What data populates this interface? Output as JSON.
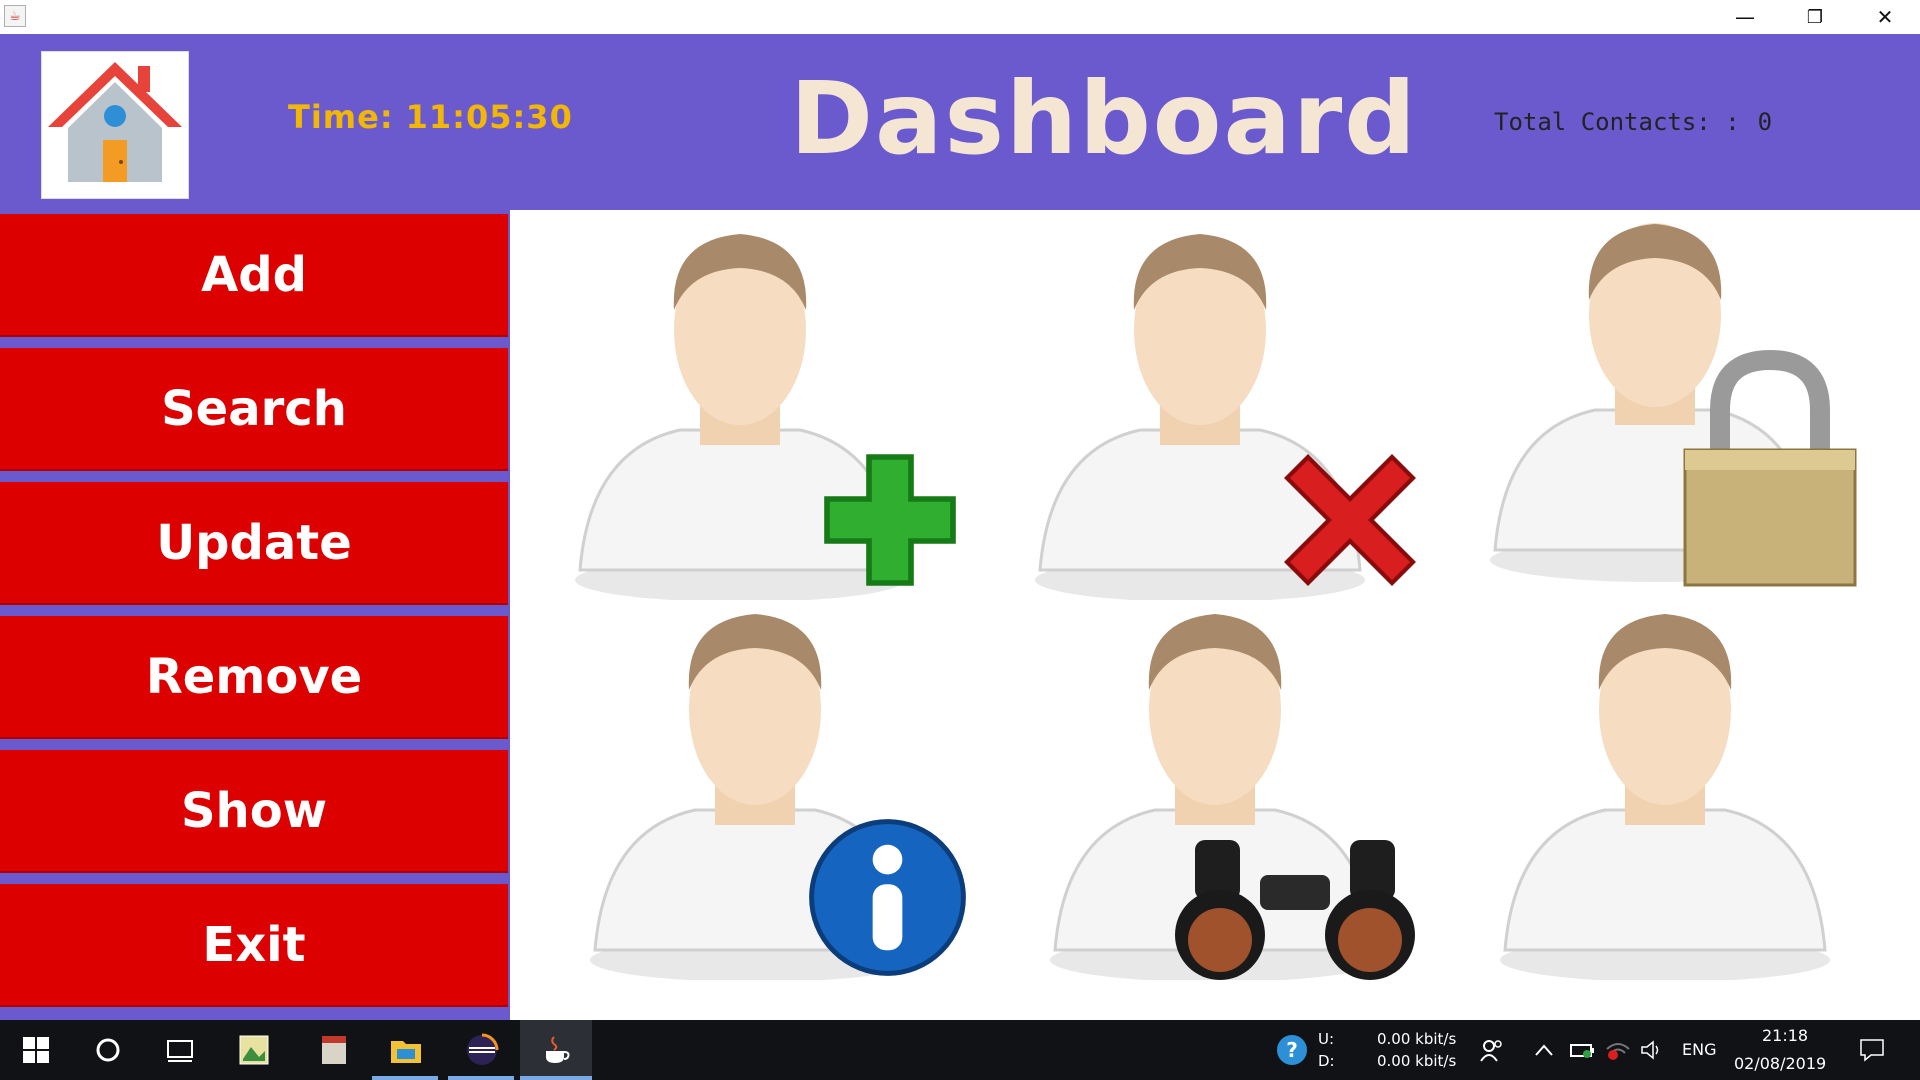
{
  "window": {
    "minimize_glyph": "—",
    "restore_glyph": "❐",
    "close_glyph": "✕",
    "app_icon": "java-cup-icon"
  },
  "header": {
    "logo_icon": "house-icon",
    "time_label": "Time:",
    "time_value": "11:05:30",
    "title": "Dashboard",
    "contacts_label": "Total Contacts: :",
    "contacts_value": "0",
    "colors": {
      "background": "#6a5acd",
      "time": "#f2b705",
      "title": "#f5e6d3"
    }
  },
  "sidebar": {
    "items": [
      {
        "label": "Add"
      },
      {
        "label": "Search"
      },
      {
        "label": "Update"
      },
      {
        "label": "Remove"
      },
      {
        "label": "Show"
      },
      {
        "label": "Exit"
      }
    ],
    "colors": {
      "button": "#dd0000",
      "separator": "#6a5acd",
      "text": "#ffffff"
    }
  },
  "tiles": [
    {
      "name": "add-user",
      "badge": "green-plus-icon"
    },
    {
      "name": "remove-user",
      "badge": "red-x-icon"
    },
    {
      "name": "lock-user",
      "badge": "padlock-icon"
    },
    {
      "name": "user-info",
      "badge": "info-icon"
    },
    {
      "name": "search-user",
      "badge": "binoculars-icon"
    },
    {
      "name": "show-user",
      "badge": ""
    }
  ],
  "taskbar": {
    "icons": [
      "windows-start-icon",
      "cortana-circle-icon",
      "task-view-icon",
      "image-viewer-icon",
      "notepad-icon",
      "file-explorer-icon",
      "eclipse-icon",
      "java-icon"
    ],
    "network_upload_label": "U:",
    "network_download_label": "D:",
    "network_upload_value": "0.00 kbit/s",
    "network_download_value": "0.00 kbit/s",
    "language": "ENG",
    "clock_time": "21:18",
    "clock_date": "02/08/2019"
  }
}
